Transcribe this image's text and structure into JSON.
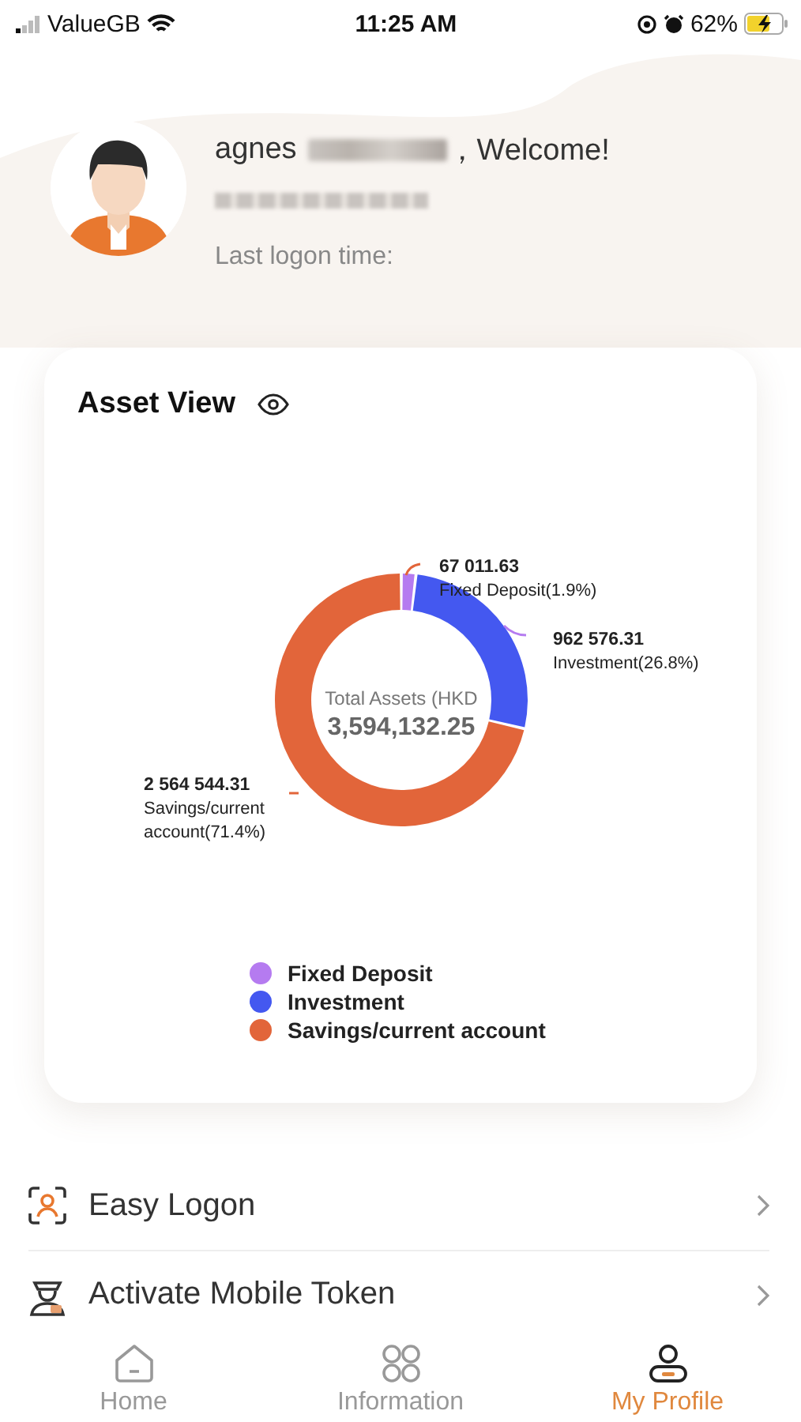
{
  "status_bar": {
    "carrier": "ValueGB",
    "time": "11:25 AM",
    "battery": "62%"
  },
  "profile": {
    "name": "agnes",
    "welcome": "，Welcome!",
    "last_logon_label": "Last logon time:"
  },
  "asset_card": {
    "title": "Asset View",
    "center_label": "Total Assets (HKD",
    "center_value": "3,594,132.25",
    "chart_data": {
      "type": "donut",
      "categories": [
        "Fixed Deposit",
        "Investment",
        "Savings/current account"
      ],
      "values": [
        67011.63,
        962576.31,
        2564544.31
      ],
      "data_labels": true
    },
    "callouts": [
      {
        "value": "67 011.63",
        "caption": "Fixed Deposit(1.9%)"
      },
      {
        "value": "962 576.31",
        "caption": "Investment(26.8%)"
      },
      {
        "value": "2 564 544.31",
        "caption": "Savings/current account(71.4%)"
      }
    ],
    "legend": [
      {
        "color": "#b57bf0"
      },
      {
        "color": "#4458f0"
      },
      {
        "color": "#e2653a"
      }
    ]
  },
  "menu": [
    {
      "label": "Easy Logon",
      "kind": "face"
    },
    {
      "label": "Activate Mobile Token",
      "kind": "token"
    }
  ],
  "tabs": [
    {
      "label": "Home",
      "kind": "home",
      "selected": false
    },
    {
      "label": "Information",
      "kind": "grid",
      "selected": false
    },
    {
      "label": "My Profile",
      "kind": "profile",
      "selected": true
    }
  ]
}
